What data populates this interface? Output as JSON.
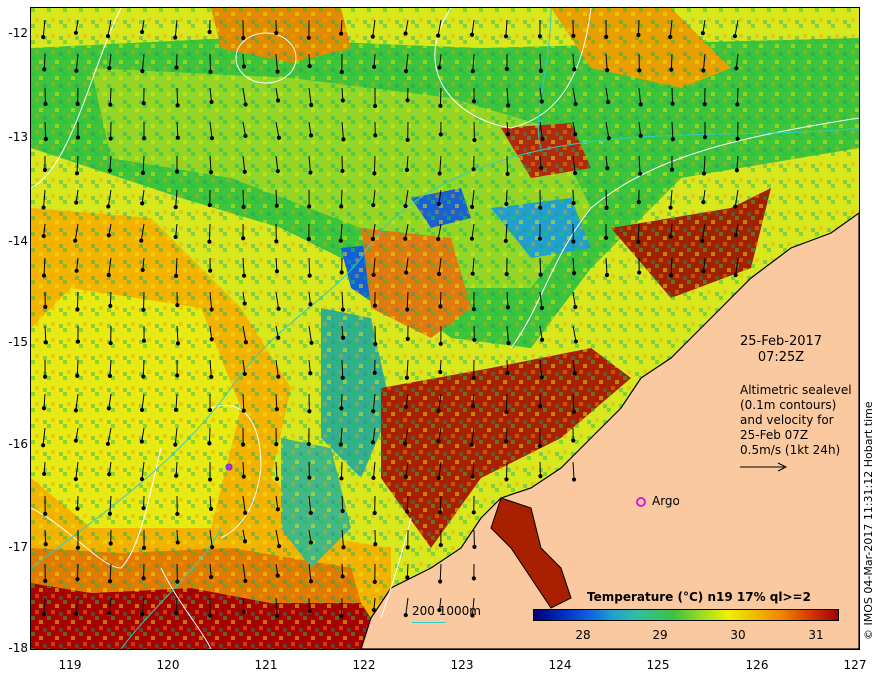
{
  "map": {
    "y_ticks": [
      "-12",
      "-13",
      "-14",
      "-15",
      "-16",
      "-17",
      "-18"
    ],
    "x_ticks": [
      "119",
      "120",
      "121",
      "122",
      "123",
      "124",
      "125",
      "126",
      "127"
    ],
    "lat_range": [
      -18,
      -11.8
    ],
    "lon_range": [
      118.6,
      127
    ],
    "colors": {
      "land": "#fac9a0",
      "coast": "#000000",
      "contour": "#ffffff",
      "bathymetry": "#2ad0c0",
      "argo": "#d020d0"
    }
  },
  "annotation": {
    "date": "25-Feb-2017",
    "time": "07:25Z",
    "altimetry_line1": "Altimetric sealevel",
    "altimetry_line2": "(0.1m contours)",
    "altimetry_line3": "and velocity for",
    "altimetry_line4": "25-Feb 07Z",
    "altimetry_line5": "0.5m/s (1kt 24h)",
    "argo_label": "Argo"
  },
  "colorbar": {
    "title": "Temperature (°C) n19 17% ql>=2",
    "ticks": [
      "28",
      "29",
      "30",
      "31"
    ]
  },
  "bathymetry_legend": "200  1000m",
  "credit": "© IMOS 04-Mar-2017 11:31:12 Hobart time"
}
